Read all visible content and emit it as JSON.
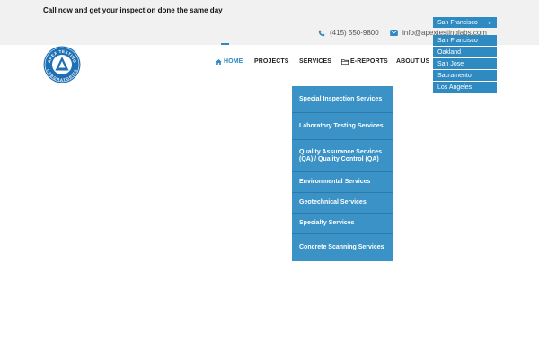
{
  "topbar": {
    "tagline": "Call now and get your inspection done the same day",
    "phone": "(415) 550-9800",
    "email": "info@apextestinglabs.com",
    "phone_icon": "phone-icon",
    "email_icon": "envelope-icon"
  },
  "logo": {
    "name": "Apex Testing Laboratories logo",
    "text_top": "APEX TESTING",
    "text_bottom": "LABORATORIES"
  },
  "nav": {
    "home": "HOME",
    "projects": "PROJECTS",
    "services": "SERVICES",
    "ereports": "E-REPORTS",
    "about": "ABOUT US"
  },
  "services_menu": [
    "Special Inspection Services",
    "Laboratory Testing Services",
    "Quality Assurance Services (QA) / Quality Control (QA)",
    "Environmental Services",
    "Geotechnical Services",
    "Specialty Services",
    "Concrete Scanning Services"
  ],
  "city_selector": {
    "selected": "San Francisco",
    "options": [
      "San Francisco",
      "Oakland",
      "San Jose",
      "Sacramento",
      "Los Angeles"
    ]
  },
  "colors": {
    "accent": "#2f8ac2",
    "menu_bg": "#3a92c6",
    "header_bg": "#f1f1f1",
    "logo_blue": "#1e6fb4"
  }
}
